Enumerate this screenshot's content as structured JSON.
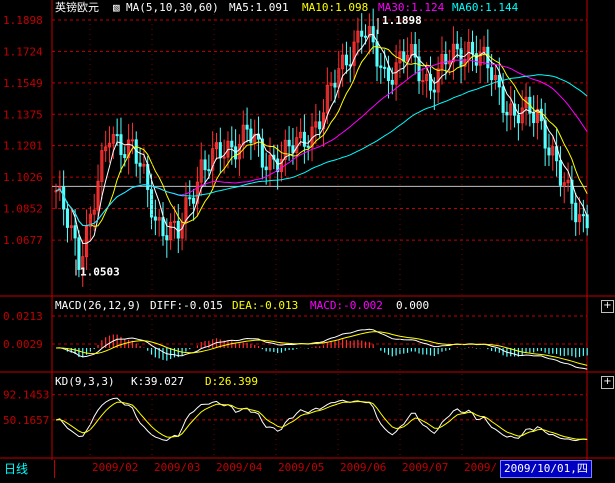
{
  "main_pane": {
    "symbol": "英镑欧元",
    "indicator": "MA(5,10,30,60)",
    "ma5": "MA5:1.091",
    "ma10": "MA10:1.098",
    "ma30": "MA30:1.124",
    "ma60": "MA60:1.144",
    "colors": {
      "ma5": "#ffffff",
      "ma10": "#ffff00",
      "ma30": "#ff00ff",
      "ma60": "#00ffff"
    },
    "high_label": "1.1898",
    "low_label": "1.0503",
    "y_ticks": [
      "1.1898",
      "1.1724",
      "1.1549",
      "1.1375",
      "1.1201",
      "1.1026",
      "1.0852",
      "1.0677"
    ]
  },
  "macd_pane": {
    "label": "MACD(26,12,9)",
    "diff": "DIFF:-0.015",
    "dea": "DEA:-0.013",
    "macd": "MACD:-0.002",
    "extra": "0.000",
    "y_ticks": [
      "0.0213",
      "0.0029"
    ],
    "add_button": "+"
  },
  "kd_pane": {
    "label": "KD(9,3,3)",
    "k": "K:39.027",
    "d": "D:26.399",
    "y_ticks": [
      "92.1453",
      "50.1657"
    ],
    "add_button": "+"
  },
  "x_axis": {
    "labels": [
      "2009/02",
      "2009/03",
      "2009/04",
      "2009/05",
      "2009/06",
      "2009/07",
      "2009/"
    ]
  },
  "status": {
    "period": "日线",
    "cursor_date": "2009/10/01,四"
  },
  "chart_data": {
    "type": "candlestick",
    "title": "英镑欧元",
    "ylim": [
      1.05,
      1.1898
    ],
    "marked_high": 1.1898,
    "marked_low": 1.0503,
    "anchors_close": [
      [
        0,
        1.095
      ],
      [
        6,
        1.058
      ],
      [
        10,
        1.09
      ],
      [
        14,
        1.125
      ],
      [
        20,
        1.12
      ],
      [
        26,
        1.08
      ],
      [
        32,
        1.07
      ],
      [
        38,
        1.11
      ],
      [
        44,
        1.115
      ],
      [
        50,
        1.13
      ],
      [
        54,
        1.11
      ],
      [
        58,
        1.115
      ],
      [
        64,
        1.12
      ],
      [
        70,
        1.14
      ],
      [
        76,
        1.17
      ],
      [
        80,
        1.185
      ],
      [
        86,
        1.16
      ],
      [
        92,
        1.17
      ],
      [
        98,
        1.155
      ],
      [
        104,
        1.17
      ],
      [
        108,
        1.175
      ],
      [
        114,
        1.16
      ],
      [
        120,
        1.135
      ],
      [
        126,
        1.14
      ],
      [
        132,
        1.1
      ],
      [
        138,
        1.08
      ]
    ],
    "ma_last": {
      "MA5": 1.091,
      "MA10": 1.098,
      "MA30": 1.124,
      "MA60": 1.144
    },
    "macd_last": {
      "DIFF": -0.015,
      "DEA": -0.013,
      "MACD": -0.002
    },
    "kd_last": {
      "K": 39.027,
      "D": 26.399
    }
  }
}
